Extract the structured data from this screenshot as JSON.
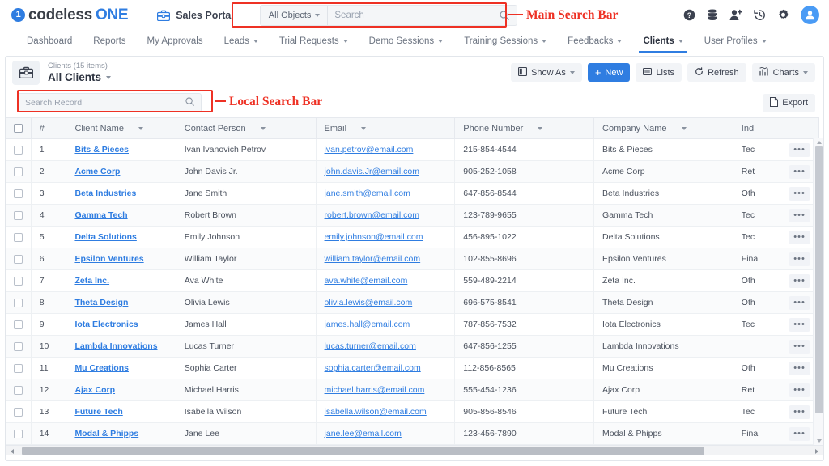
{
  "brand": {
    "mark": "1",
    "name_part1": "codeless",
    "name_part2": "ONE",
    "accent": "#2f7de1"
  },
  "topbar": {
    "portal_label": "Sales Portal",
    "search": {
      "scope_label": "All Objects",
      "placeholder": "Search",
      "value": ""
    },
    "icons": [
      {
        "name": "help-icon",
        "label": "Help"
      },
      {
        "name": "database-icon",
        "label": "Data"
      },
      {
        "name": "add-user-icon",
        "label": "Add User"
      },
      {
        "name": "history-icon",
        "label": "History"
      },
      {
        "name": "gear-icon",
        "label": "Settings"
      },
      {
        "name": "user-avatar",
        "label": "Account"
      }
    ]
  },
  "annotations": {
    "main_search": "Main Search Bar",
    "local_search": "Local Search Bar",
    "color": "#ee3124"
  },
  "nav": {
    "tabs": [
      {
        "label": "Dashboard",
        "caret": false,
        "active": false
      },
      {
        "label": "Reports",
        "caret": false,
        "active": false
      },
      {
        "label": "My Approvals",
        "caret": false,
        "active": false
      },
      {
        "label": "Leads",
        "caret": true,
        "active": false
      },
      {
        "label": "Trial Requests",
        "caret": true,
        "active": false
      },
      {
        "label": "Demo Sessions",
        "caret": true,
        "active": false
      },
      {
        "label": "Training Sessions",
        "caret": true,
        "active": false
      },
      {
        "label": "Feedbacks",
        "caret": true,
        "active": false
      },
      {
        "label": "Clients",
        "caret": true,
        "active": true
      },
      {
        "label": "User Profiles",
        "caret": true,
        "active": false
      }
    ]
  },
  "list_header": {
    "subtitle": "Clients (15 items)",
    "title": "All Clients",
    "actions": [
      {
        "name": "show-as-button",
        "label": "Show As",
        "icon": "panel-icon",
        "caret": true,
        "primary": false
      },
      {
        "name": "new-button",
        "label": "New",
        "icon": "plus-icon",
        "caret": false,
        "primary": true
      },
      {
        "name": "lists-button",
        "label": "Lists",
        "icon": "list-icon",
        "caret": false,
        "primary": false
      },
      {
        "name": "refresh-button",
        "label": "Refresh",
        "icon": "refresh-icon",
        "caret": false,
        "primary": false
      },
      {
        "name": "charts-button",
        "label": "Charts",
        "icon": "chart-icon",
        "caret": true,
        "primary": false
      }
    ]
  },
  "local_search": {
    "placeholder": "Search Record",
    "value": ""
  },
  "export_button": {
    "label": "Export",
    "icon": "document-icon"
  },
  "table": {
    "columns": [
      {
        "key": "num",
        "label": "#",
        "sortable": false
      },
      {
        "key": "client_name",
        "label": "Client Name",
        "sortable": true
      },
      {
        "key": "contact_person",
        "label": "Contact Person",
        "sortable": true
      },
      {
        "key": "email",
        "label": "Email",
        "sortable": true
      },
      {
        "key": "phone",
        "label": "Phone Number",
        "sortable": true
      },
      {
        "key": "company_name",
        "label": "Company Name",
        "sortable": true
      },
      {
        "key": "industry",
        "label": "Ind",
        "sortable": false
      }
    ],
    "rows": [
      {
        "num": "1",
        "client_name": "Bits & Pieces",
        "contact_person": "Ivan Ivanovich Petrov",
        "email": "ivan.petrov@email.com",
        "phone": "215-854-4544",
        "company_name": "Bits & Pieces",
        "industry": "Tec"
      },
      {
        "num": "2",
        "client_name": "Acme Corp",
        "contact_person": "John Davis Jr.",
        "email": "john.davis.Jr@email.com",
        "phone": "905-252-1058",
        "company_name": "Acme Corp",
        "industry": "Ret"
      },
      {
        "num": "3",
        "client_name": "Beta Industries",
        "contact_person": "Jane Smith",
        "email": "jane.smith@email.com",
        "phone": "647-856-8544",
        "company_name": "Beta Industries",
        "industry": "Oth"
      },
      {
        "num": "4",
        "client_name": "Gamma Tech",
        "contact_person": "Robert Brown",
        "email": "robert.brown@email.com",
        "phone": "123-789-9655",
        "company_name": "Gamma Tech",
        "industry": "Tec"
      },
      {
        "num": "5",
        "client_name": "Delta Solutions",
        "contact_person": "Emily Johnson",
        "email": "emily.johnson@email.com",
        "phone": "456-895-1022",
        "company_name": "Delta Solutions",
        "industry": "Tec"
      },
      {
        "num": "6",
        "client_name": "Epsilon Ventures",
        "contact_person": "William Taylor",
        "email": "william.taylor@email.com",
        "phone": "102-855-8696",
        "company_name": "Epsilon Ventures",
        "industry": "Fina"
      },
      {
        "num": "7",
        "client_name": "Zeta Inc.",
        "contact_person": "Ava White",
        "email": "ava.white@email.com",
        "phone": "559-489-2214",
        "company_name": "Zeta Inc.",
        "industry": "Oth"
      },
      {
        "num": "8",
        "client_name": "Theta Design",
        "contact_person": "Olivia Lewis",
        "email": "olivia.lewis@email.com",
        "phone": "696-575-8541",
        "company_name": "Theta Design",
        "industry": "Oth"
      },
      {
        "num": "9",
        "client_name": "Iota Electronics",
        "contact_person": "James Hall",
        "email": "james.hall@email.com",
        "phone": "787-856-7532",
        "company_name": "Iota Electronics",
        "industry": "Tec"
      },
      {
        "num": "10",
        "client_name": "Lambda Innovations",
        "contact_person": "Lucas Turner",
        "email": "lucas.turner@email.com",
        "phone": "647-856-1255",
        "company_name": "Lambda Innovations",
        "industry": ""
      },
      {
        "num": "11",
        "client_name": "Mu Creations",
        "contact_person": "Sophia Carter",
        "email": "sophia.carter@email.com",
        "phone": "112-856-8565",
        "company_name": "Mu Creations",
        "industry": "Oth"
      },
      {
        "num": "12",
        "client_name": "Ajax Corp",
        "contact_person": "Michael Harris",
        "email": "michael.harris@email.com",
        "phone": "555-454-1236",
        "company_name": "Ajax Corp",
        "industry": "Ret"
      },
      {
        "num": "13",
        "client_name": "Future Tech",
        "contact_person": "Isabella Wilson",
        "email": "isabella.wilson@email.com",
        "phone": "905-856-8546",
        "company_name": "Future Tech",
        "industry": "Tec"
      },
      {
        "num": "14",
        "client_name": "Modal & Phipps",
        "contact_person": "Jane Lee",
        "email": "jane.lee@email.com",
        "phone": "123-456-7890",
        "company_name": "Modal & Phipps",
        "industry": "Fina"
      }
    ],
    "row_menu_label": "•••"
  }
}
